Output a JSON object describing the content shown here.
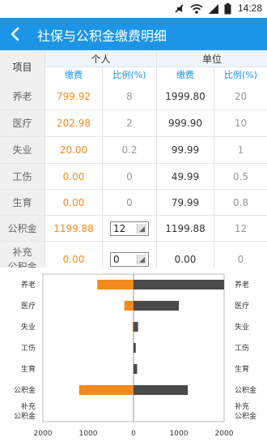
{
  "status": {
    "time": "14:28"
  },
  "header": {
    "title": "社保与公积金缴费明细"
  },
  "table": {
    "item_header": "项目",
    "personal_header": "个人",
    "company_header": "单位",
    "fee_header": "缴费",
    "ratio_header": "比例(%)",
    "rows": [
      {
        "label": "养老",
        "p_fee": "799.92",
        "p_ratio": "8",
        "c_fee": "1999.80",
        "c_ratio": "20"
      },
      {
        "label": "医疗",
        "p_fee": "202.98",
        "p_ratio": "2",
        "c_fee": "999.90",
        "c_ratio": "10"
      },
      {
        "label": "失业",
        "p_fee": "20.00",
        "p_ratio": "0.2",
        "c_fee": "99.99",
        "c_ratio": "1"
      },
      {
        "label": "工伤",
        "p_fee": "0.00",
        "p_ratio": "0",
        "c_fee": "49.99",
        "c_ratio": "0.5"
      },
      {
        "label": "生育",
        "p_fee": "0.00",
        "p_ratio": "0",
        "c_fee": "79.99",
        "c_ratio": "0.8"
      },
      {
        "label": "公积金",
        "p_fee": "1199.88",
        "p_ratio": "12",
        "c_fee": "1199.88",
        "c_ratio": "12"
      },
      {
        "label": "补充\n公积金",
        "p_fee": "0.00",
        "p_ratio": "0",
        "c_fee": "0.00",
        "c_ratio": "0"
      }
    ]
  },
  "colors": {
    "accent": "#1d95e6",
    "personal": "#f28a1e",
    "company": "#4a4a4a"
  },
  "chart_data": {
    "type": "bar",
    "orientation": "horizontal",
    "categories": [
      "养老",
      "医疗",
      "失业",
      "工伤",
      "生育",
      "公积金",
      "补充公积金"
    ],
    "category_labels": [
      "养老",
      "医疗",
      "失业",
      "工伤",
      "生育",
      "公积金",
      "补充\n公积金"
    ],
    "series": [
      {
        "color": "#f28a1e",
        "values": [
          799.92,
          202.98,
          20.0,
          0.0,
          0.0,
          1199.88,
          0.0
        ],
        "direction": "left"
      },
      {
        "color": "#4a4a4a",
        "values": [
          1999.8,
          999.9,
          99.99,
          49.99,
          79.99,
          1199.88,
          0.0
        ],
        "direction": "right"
      }
    ],
    "xlim": [
      -2000,
      2000
    ],
    "xtick_labels": [
      "2000",
      "1000",
      "0",
      "1000",
      "2000"
    ],
    "grid": false
  }
}
